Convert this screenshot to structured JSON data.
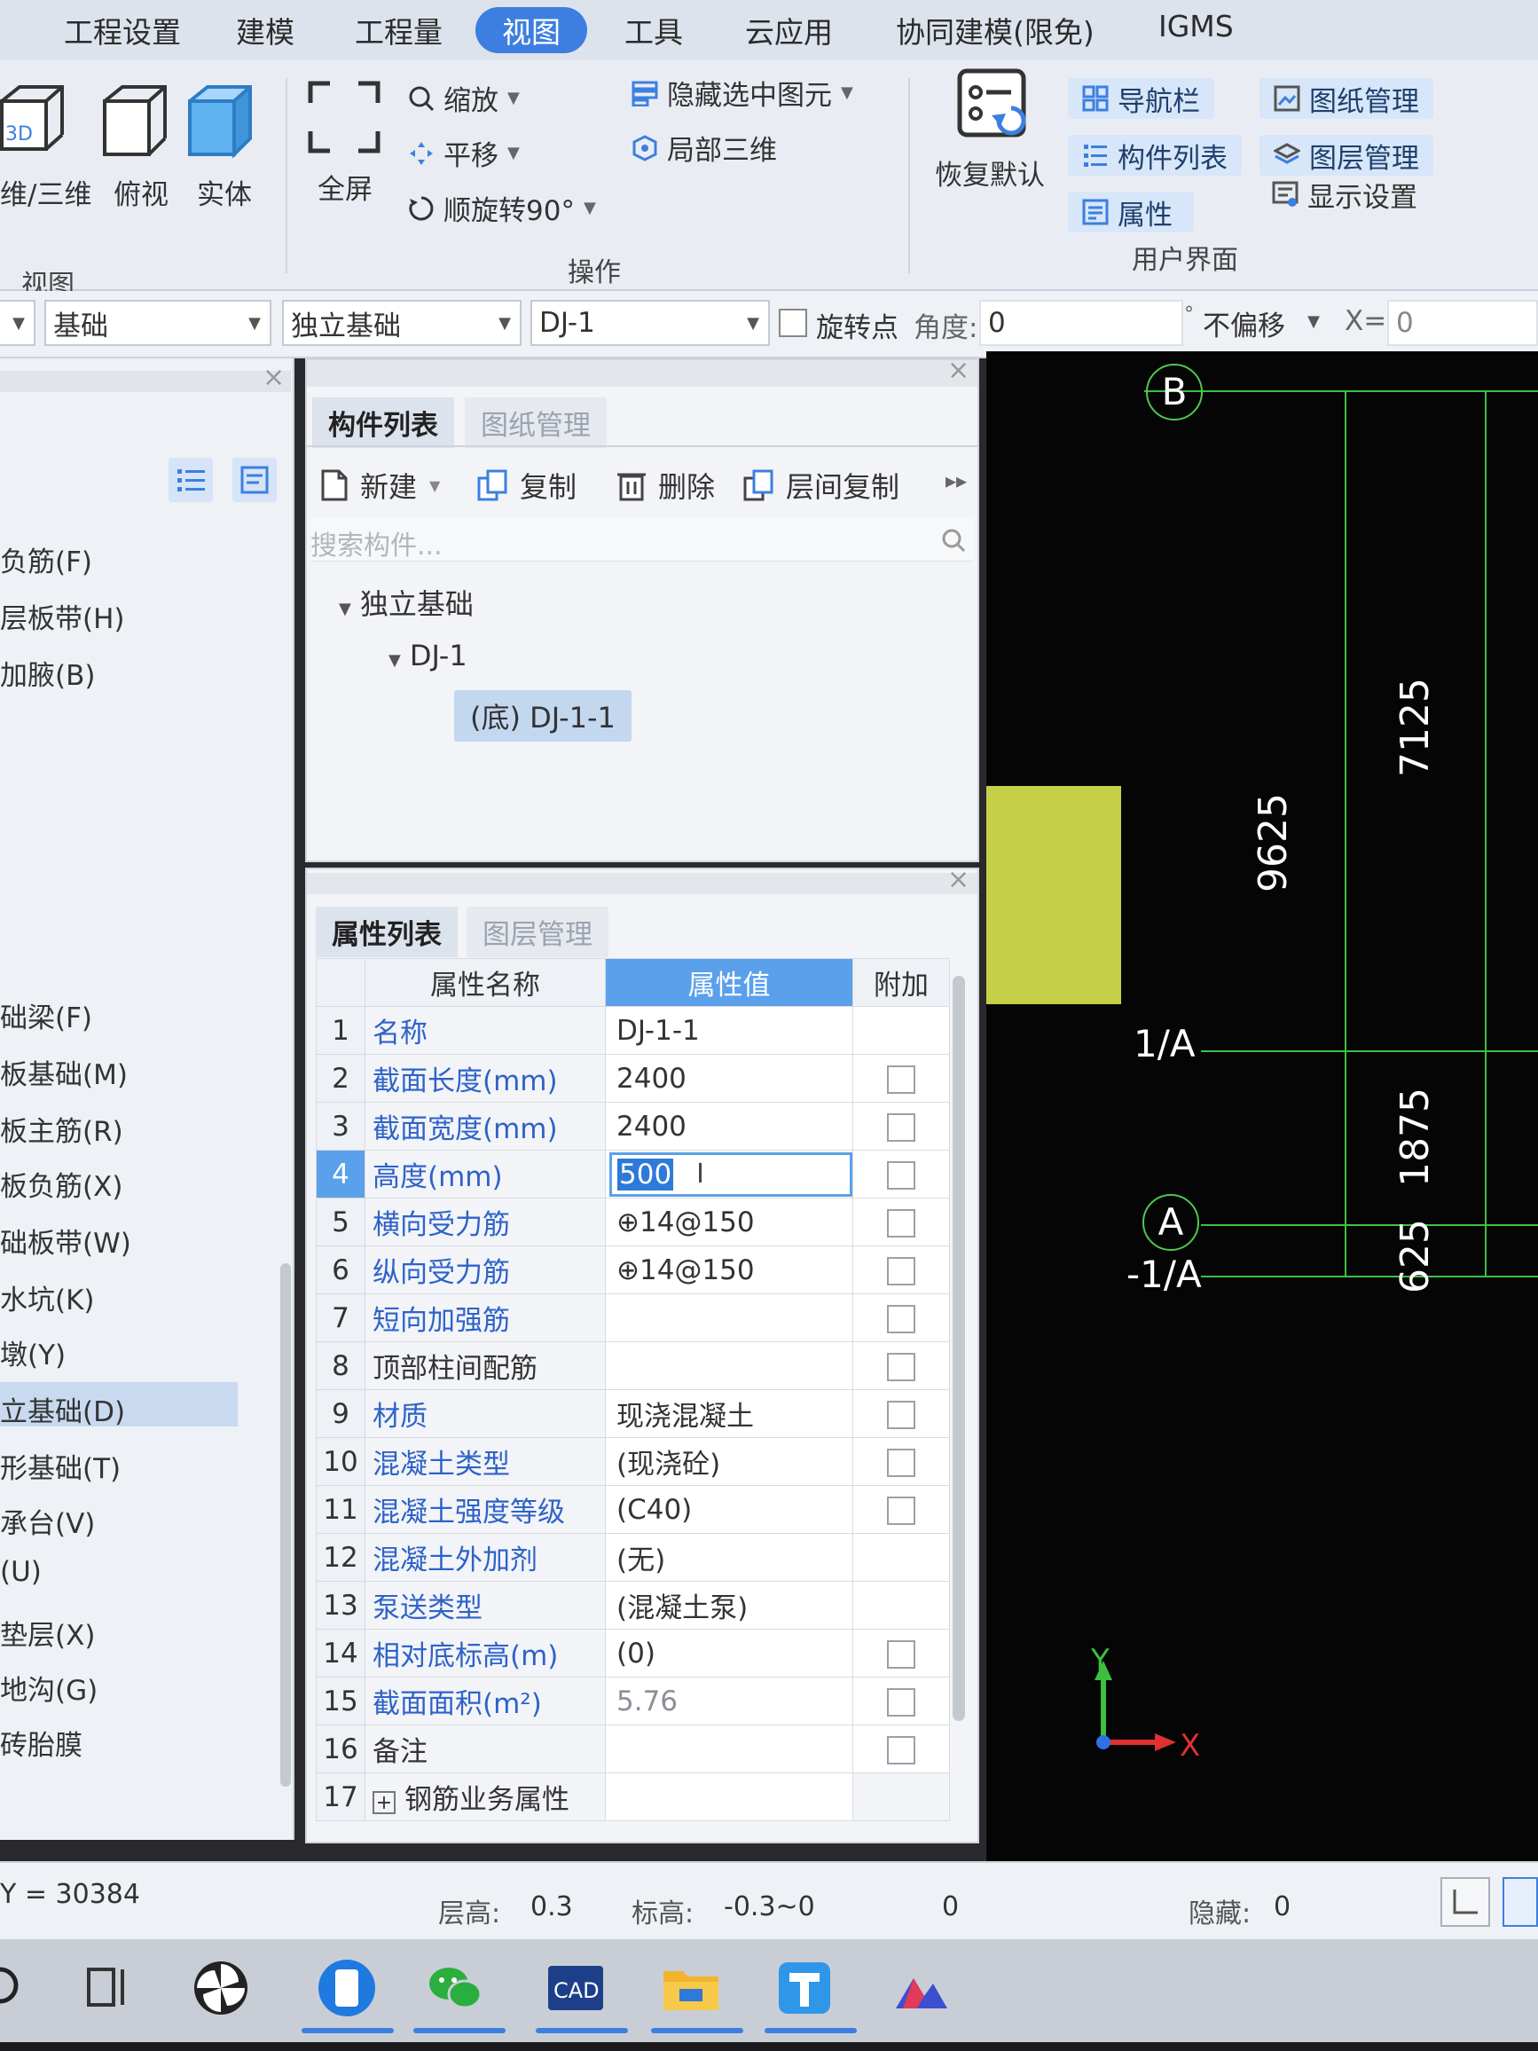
{
  "menu": {
    "items": [
      "工程设置",
      "建模",
      "工程量",
      "视图",
      "工具",
      "云应用",
      "协同建模(限免)",
      "IGMS"
    ],
    "active": "视图"
  },
  "ribbon": {
    "view_group": {
      "label": "视图",
      "btn_3d": "维/三维",
      "btn_top": "俯视",
      "btn_solid": "实体"
    },
    "ops_group": {
      "label": "操作",
      "fullscreen": "全屏",
      "zoom": "缩放",
      "pan": "平移",
      "rotate": "顺旋转90°",
      "hide_selected": "隐藏选中图元",
      "local_3d": "局部三维"
    },
    "ui_group": {
      "label": "用户界面",
      "restore": "恢复默认",
      "navbar": "导航栏",
      "comp_list": "构件列表",
      "properties": "属性",
      "drawing_mgmt": "图纸管理",
      "layer_mgmt": "图层管理",
      "display_settings": "显示设置"
    }
  },
  "toolbar2": {
    "floor": "基础",
    "type": "独立基础",
    "component": "DJ-1",
    "rotate_point": "旋转点",
    "angle_label": "角度:",
    "angle_value": "0",
    "offset": "不偏移",
    "x_label": "X=",
    "x_value": "0"
  },
  "left_panel": {
    "items": [
      "负筋(F)",
      "层板带(H)",
      "加腋(B)",
      "础梁(F)",
      "板基础(M)",
      "板主筋(R)",
      "板负筋(X)",
      "础板带(W)",
      "水坑(K)",
      "墩(Y)",
      "立基础(D)",
      "形基础(T)",
      "承台(V)",
      "(U)",
      "垫层(X)",
      "地沟(G)",
      "砖胎膜"
    ],
    "selected": "立基础(D)"
  },
  "comp_list": {
    "tab_active": "构件列表",
    "tab_inactive": "图纸管理",
    "tools": {
      "new": "新建",
      "copy": "复制",
      "delete": "删除",
      "floor_copy": "层间复制"
    },
    "search_placeholder": "搜索构件...",
    "tree": {
      "root": "独立基础",
      "child": "DJ-1",
      "leaf": "(底) DJ-1-1"
    }
  },
  "props": {
    "tab_active": "属性列表",
    "tab_inactive": "图层管理",
    "headers": {
      "name": "属性名称",
      "value": "属性值",
      "extra": "附加"
    },
    "rows": [
      {
        "idx": "1",
        "name": "名称",
        "value": "DJ-1-1"
      },
      {
        "idx": "2",
        "name": "截面长度(mm)",
        "value": "2400"
      },
      {
        "idx": "3",
        "name": "截面宽度(mm)",
        "value": "2400"
      },
      {
        "idx": "4",
        "name": "高度(mm)",
        "value": "500"
      },
      {
        "idx": "5",
        "name": "横向受力筋",
        "value": "⊕14@150"
      },
      {
        "idx": "6",
        "name": "纵向受力筋",
        "value": "⊕14@150"
      },
      {
        "idx": "7",
        "name": "短向加强筋",
        "value": ""
      },
      {
        "idx": "8",
        "name": "顶部柱间配筋",
        "value": ""
      },
      {
        "idx": "9",
        "name": "材质",
        "value": "现浇混凝土"
      },
      {
        "idx": "10",
        "name": "混凝土类型",
        "value": "(现浇砼)"
      },
      {
        "idx": "11",
        "name": "混凝土强度等级",
        "value": "(C40)"
      },
      {
        "idx": "12",
        "name": "混凝土外加剂",
        "value": "(无)"
      },
      {
        "idx": "13",
        "name": "泵送类型",
        "value": "(混凝土泵)"
      },
      {
        "idx": "14",
        "name": "相对底标高(m)",
        "value": "(0)"
      },
      {
        "idx": "15",
        "name": "截面面积(m²)",
        "value": "5.76"
      },
      {
        "idx": "16",
        "name": "备注",
        "value": ""
      },
      {
        "idx": "17",
        "name": "钢筋业务属性",
        "value": ""
      }
    ]
  },
  "cad": {
    "axis_b": "B",
    "axis_1a": "1/A",
    "axis_a": "A",
    "axis_m1a": "-1/A",
    "dim_9625": "9625",
    "dim_7125": "7125",
    "dim_1875": "1875",
    "dim_625": "625",
    "y_axis": "Y",
    "x_axis": "X"
  },
  "status": {
    "coord": "Y = 30384",
    "floor_height_label": "层高:",
    "floor_height": "0.3",
    "elev_label": "标高:",
    "elev": "-0.3~0",
    "count": "0",
    "hidden_label": "隐藏:",
    "hidden": "0"
  },
  "colors": {
    "accent": "#3d7fe0",
    "selected_header": "#5aa0ea",
    "footing": "#c5cf47",
    "grid": "#3fbf3f"
  }
}
